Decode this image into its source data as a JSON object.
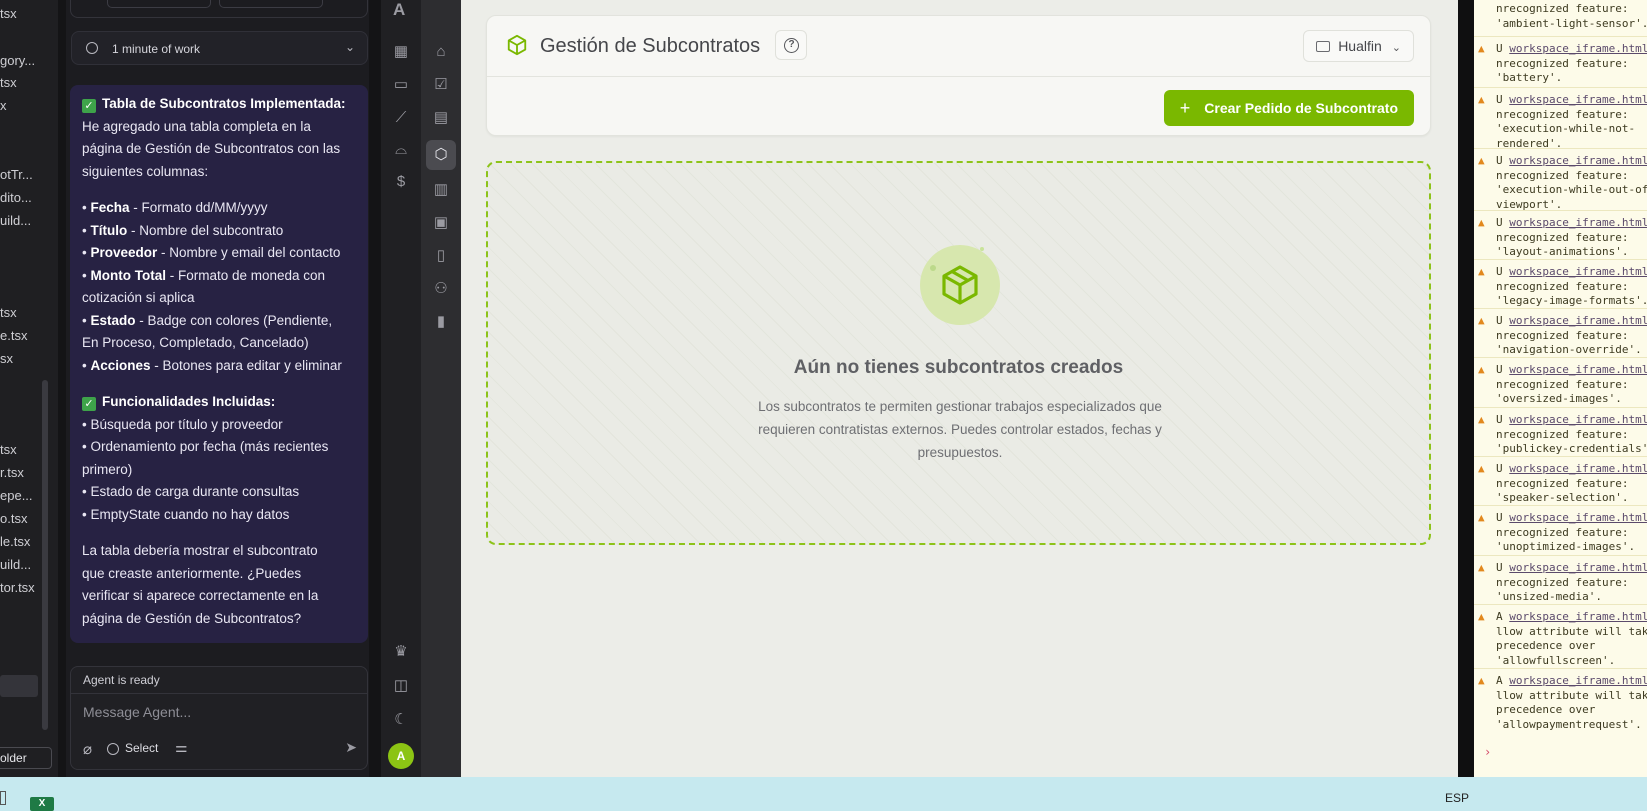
{
  "files": {
    "items": [
      "tsx",
      "gory...",
      "tsx",
      "x",
      "otTr...",
      "dito...",
      "uild...",
      "tsx",
      "e.tsx",
      "sx",
      "tsx",
      "r.tsx",
      "epe...",
      "o.tsx",
      "le.tsx",
      "uild...",
      "tor.tsx"
    ],
    "folder_button": "older"
  },
  "chat": {
    "work_label": "1 minute of work",
    "message": {
      "section1_title": "Tabla de Subcontratos Implementada:",
      "intro_lines": [
        "He agregado una tabla completa en la",
        "página de Gestión de Subcontratos con las",
        "siguientes columnas:"
      ],
      "columns": [
        {
          "name": "Fecha",
          "desc": " - Formato dd/MM/yyyy"
        },
        {
          "name": "Título",
          "desc": " - Nombre del subcontrato"
        },
        {
          "name": "Proveedor",
          "desc": " - Nombre y email del contacto"
        },
        {
          "name": "Monto Total",
          "desc": " - Formato de moneda con"
        },
        {
          "name": "",
          "desc": "cotización si aplica"
        },
        {
          "name": "Estado",
          "desc": " - Badge con colores (Pendiente,"
        },
        {
          "name": "",
          "desc": "En Proceso, Completado, Cancelado)"
        },
        {
          "name": "Acciones",
          "desc": " - Botones para editar y eliminar"
        }
      ],
      "section2_title": "Funcionalidades Incluidas:",
      "features": [
        "• Búsqueda por título y proveedor",
        "• Ordenamiento por fecha (más recientes",
        "primero)",
        "• Estado de carga durante consultas",
        "• EmptyState cuando no hay datos"
      ],
      "closing_lines": [
        "La tabla debería mostrar el subcontrato",
        "que creaste anteriormente. ¿Puedes",
        "verificar si aparece correctamente en la",
        "página de Gestión de Subcontratos?"
      ]
    },
    "status": "Agent is ready",
    "input_placeholder": "Message Agent...",
    "select_label": "Select"
  },
  "rail": {
    "logo": "A",
    "avatar_initial": "A",
    "icons": [
      "building-icon",
      "folder-icon",
      "brush-icon",
      "helmet-icon",
      "dollar-icon",
      "home-icon",
      "check-square-icon",
      "calendar-icon",
      "cube-icon",
      "calculator-icon",
      "briefcase-icon",
      "document-icon",
      "users-icon",
      "bar-chart-icon",
      "crown-icon",
      "sidebar-toggle-icon",
      "moon-icon"
    ]
  },
  "app": {
    "page_title": "Gestión de Subcontratos",
    "project_selector": "Hualfin",
    "create_button": "Crear Pedido de Subcontrato",
    "empty_title": "Aún no tienes subcontratos creados",
    "empty_description": "Los subcontratos te permiten gestionar trabajos especializados que requieren contratistas externos. Puedes controlar estados, fechas y presupuestos.",
    "accent_color": "#7ab800"
  },
  "console": {
    "first_lines": [
      "nrecognized feature:",
      "'ambient-light-sensor'."
    ],
    "entries": [
      {
        "prefix": "U",
        "link": "workspace_iframe.html:",
        "lines": [
          "nrecognized feature:",
          "'battery'."
        ]
      },
      {
        "prefix": "U",
        "link": "workspace_iframe.html:",
        "lines": [
          "nrecognized feature:",
          "'execution-while-not-",
          "rendered'."
        ]
      },
      {
        "prefix": "U",
        "link": "workspace_iframe.html:",
        "lines": [
          "nrecognized feature:",
          "'execution-while-out-of-",
          "viewport'."
        ]
      },
      {
        "prefix": "U",
        "link": "workspace_iframe.html:",
        "lines": [
          "nrecognized feature:",
          "'layout-animations'."
        ]
      },
      {
        "prefix": "U",
        "link": "workspace_iframe.html:",
        "lines": [
          "nrecognized feature:",
          "'legacy-image-formats'."
        ]
      },
      {
        "prefix": "U",
        "link": "workspace_iframe.html:",
        "lines": [
          "nrecognized feature:",
          "'navigation-override'."
        ]
      },
      {
        "prefix": "U",
        "link": "workspace_iframe.html:",
        "lines": [
          "nrecognized feature:",
          "'oversized-images'."
        ]
      },
      {
        "prefix": "U",
        "link": "workspace_iframe.html:",
        "lines": [
          "nrecognized feature:",
          "'publickey-credentials'."
        ]
      },
      {
        "prefix": "U",
        "link": "workspace_iframe.html:",
        "lines": [
          "nrecognized feature:",
          "'speaker-selection'."
        ]
      },
      {
        "prefix": "U",
        "link": "workspace_iframe.html:",
        "lines": [
          "nrecognized feature:",
          "'unoptimized-images'."
        ]
      },
      {
        "prefix": "U",
        "link": "workspace_iframe.html:",
        "lines": [
          "nrecognized feature:",
          "'unsized-media'."
        ]
      },
      {
        "prefix": "A",
        "link": "workspace_iframe.html:",
        "lines": [
          "llow attribute will take",
          "precedence over",
          "'allowfullscreen'."
        ]
      },
      {
        "prefix": "A",
        "link": "workspace_iframe.html:",
        "lines": [
          "llow attribute will take",
          "precedence over",
          "'allowpaymentrequest'."
        ]
      }
    ],
    "prompt": "›"
  },
  "taskbar": {
    "language": "ESP",
    "excel_label": "X"
  }
}
